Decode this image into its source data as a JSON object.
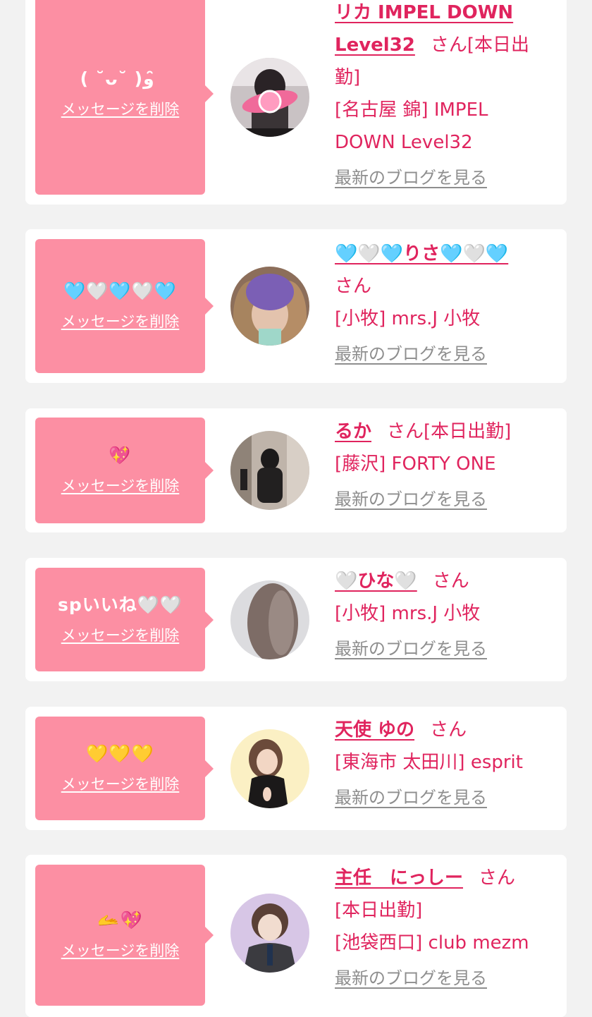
{
  "delete_label": "メッセージを削除",
  "blog_label": "最新のブログを見る",
  "san_label": "さん",
  "cards": [
    {
      "message": "( ˘ᴗ˘ )و ̑̑",
      "name": "リカ IMPEL DOWN Level32",
      "status": "[本日出勤]",
      "shop": "[名古屋 錦] IMPEL DOWN Level32"
    },
    {
      "message": "🩵🤍🩵🤍🩵",
      "name": "🩵🤍🩵りさ🩵🤍🩵",
      "status": "",
      "shop": "[小牧] mrs.J 小牧"
    },
    {
      "message": "💖",
      "name": "るか",
      "status": "[本日出勤]",
      "shop": "[藤沢] FORTY ONE"
    },
    {
      "message": "spいいね🤍🤍",
      "name": "🤍ひな🤍",
      "status": "",
      "shop": "[小牧] mrs.J 小牧"
    },
    {
      "message": "💛💛💛",
      "name": "天使 ゆの",
      "status": "",
      "shop": "[東海市 太田川] esprit"
    },
    {
      "message": "🫴💖",
      "name": "主任　にっしー",
      "status": "[本日出勤]",
      "shop": "[池袋西口] club mezm"
    }
  ],
  "colors": {
    "bubble": "#fc8fa3",
    "accent": "#e0245e",
    "link_gray": "#8e8e8e",
    "background": "#f2f2f2"
  }
}
